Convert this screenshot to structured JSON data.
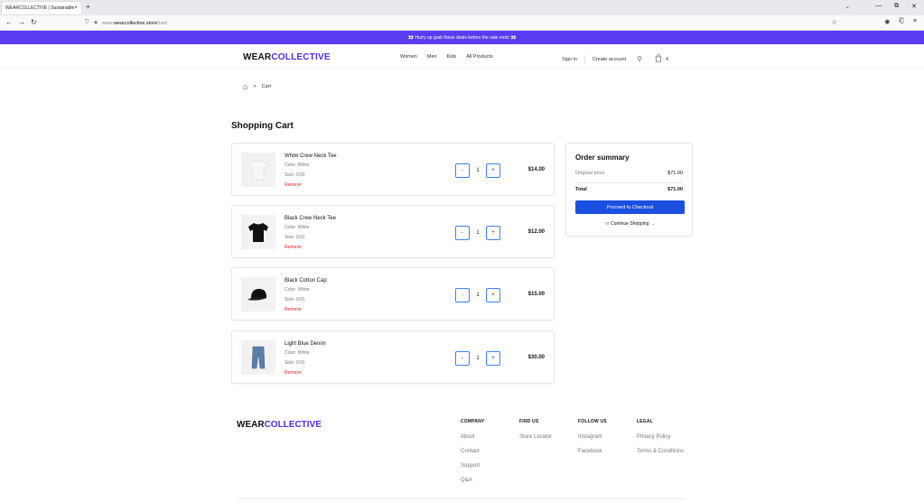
{
  "browser": {
    "tab_title": "WEARCOLLECTIVE | Sustainable",
    "tab_close": "×",
    "new_tab": "+",
    "url_prefix": "www.",
    "url_domain": "wearcollective.store",
    "url_path": "/cart",
    "controls": {
      "chevron": "⌄",
      "minimize": "—",
      "restore": "⧉",
      "close": "✕"
    }
  },
  "promo": {
    "text": "👀 Hurry up grab these deals before the sale ends 👀"
  },
  "header": {
    "logo_part1": "WEAR",
    "logo_part2": "COLLECTIVE",
    "nav": [
      "Women",
      "Men",
      "Kids",
      "All Products"
    ],
    "sign_in": "Sign in",
    "create_account": "Create account",
    "cart_count": "4"
  },
  "breadcrumb": {
    "current": "Cart",
    "separator": ">"
  },
  "page_title": "Shopping Cart",
  "cart": {
    "minus": "-",
    "plus": "+",
    "remove_label": "Remove",
    "items": [
      {
        "name": "White Crew Neck Tee",
        "color": "Color: White",
        "size": "Size: XXS",
        "qty": "1",
        "price": "$14.00",
        "icon": "white-tshirt-icon"
      },
      {
        "name": "Black Crew Neck Tee",
        "color": "Color: White",
        "size": "Size: XXS",
        "qty": "1",
        "price": "$12.00",
        "icon": "black-tshirt-icon"
      },
      {
        "name": "Black Cotton Cap",
        "color": "Color: White",
        "size": "Size: XXS",
        "qty": "1",
        "price": "$15.00",
        "icon": "black-cap-icon"
      },
      {
        "name": "Light Blue Denim",
        "color": "Color: White",
        "size": "Size: XXS",
        "qty": "1",
        "price": "$30.00",
        "icon": "denim-jeans-icon"
      }
    ]
  },
  "summary": {
    "title": "Order summary",
    "original_label": "Original price",
    "original_value": "$71.00",
    "total_label": "Total",
    "total_value": "$71.00",
    "checkout_label": "Proceed to Checkout",
    "continue_or": "or",
    "continue_label": "Continue Shopping →"
  },
  "footer": {
    "logo_part1": "WEAR",
    "logo_part2": "COLLECTIVE",
    "columns": [
      {
        "heading": "COMPANY",
        "links": [
          "About",
          "Contact",
          "Support",
          "Q&A"
        ]
      },
      {
        "heading": "FIND US",
        "links": [
          "Store Locator"
        ]
      },
      {
        "heading": "FOLLOW US",
        "links": [
          "Instagram",
          "Facebook"
        ]
      },
      {
        "heading": "LEGAL",
        "links": [
          "Privacy Policy",
          "Terms & Conditions"
        ]
      }
    ]
  },
  "colors": {
    "brand": "#4b2ee8",
    "promo_bg": "#5b3bf0",
    "checkout_bg": "#1a4fe0",
    "remove": "#e01818"
  }
}
